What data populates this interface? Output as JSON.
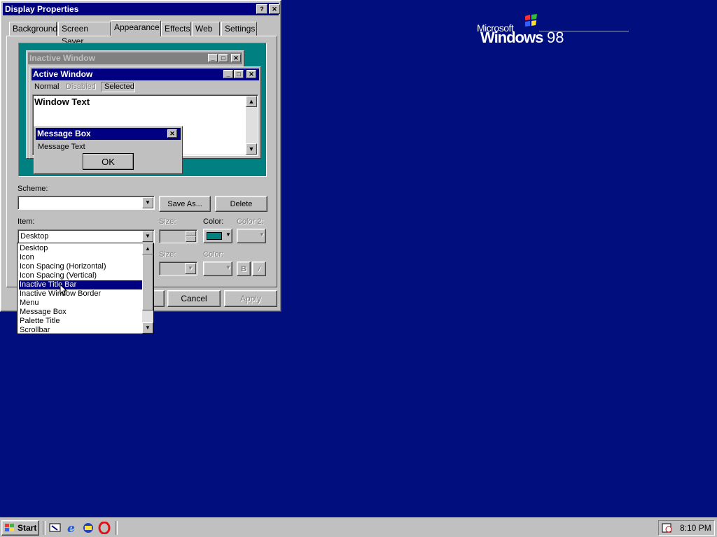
{
  "desktop": {
    "logo_microsoft": "Microsoft",
    "logo_windows": "Windows",
    "logo_version": "98"
  },
  "dialog": {
    "title": "Display Properties",
    "help_button": "?",
    "close_button": "✕",
    "tabs": [
      {
        "label": "Background"
      },
      {
        "label": "Screen Saver"
      },
      {
        "label": "Appearance"
      },
      {
        "label": "Effects"
      },
      {
        "label": "Web"
      },
      {
        "label": "Settings"
      }
    ],
    "preview": {
      "inactive_window_title": "Inactive Window",
      "active_window_title": "Active Window",
      "menu_normal": "Normal",
      "menu_disabled": "Disabled",
      "menu_selected": "Selected",
      "window_text": "Window Text",
      "message_box_title": "Message Box",
      "message_text": "Message Text",
      "ok_label": "OK"
    },
    "scheme": {
      "label": "Scheme:",
      "value": "",
      "save_as": "Save As...",
      "delete": "Delete"
    },
    "item": {
      "label": "Item:",
      "value": "Desktop",
      "size_label": "Size:",
      "color_label": "Color:",
      "color2_label": "Color 2:",
      "color_value": "#008080",
      "options": [
        "Desktop",
        "Icon",
        "Icon Spacing (Horizontal)",
        "Icon Spacing (Vertical)",
        "Inactive Title Bar",
        "Inactive Window Border",
        "Menu",
        "Message Box",
        "Palette Title",
        "Scrollbar"
      ],
      "highlighted": "Inactive Title Bar"
    },
    "font": {
      "size_label": "Size:",
      "color_label": "Color:",
      "bold": "B",
      "italic": "/"
    },
    "buttons": {
      "cancel": "Cancel",
      "apply": "Apply"
    }
  },
  "taskbar": {
    "start_label": "Start",
    "clock": "8:10 PM",
    "quick_launch": [
      "show-desktop-icon",
      "internet-explorer-icon",
      "channels-icon",
      "opera-icon"
    ]
  }
}
